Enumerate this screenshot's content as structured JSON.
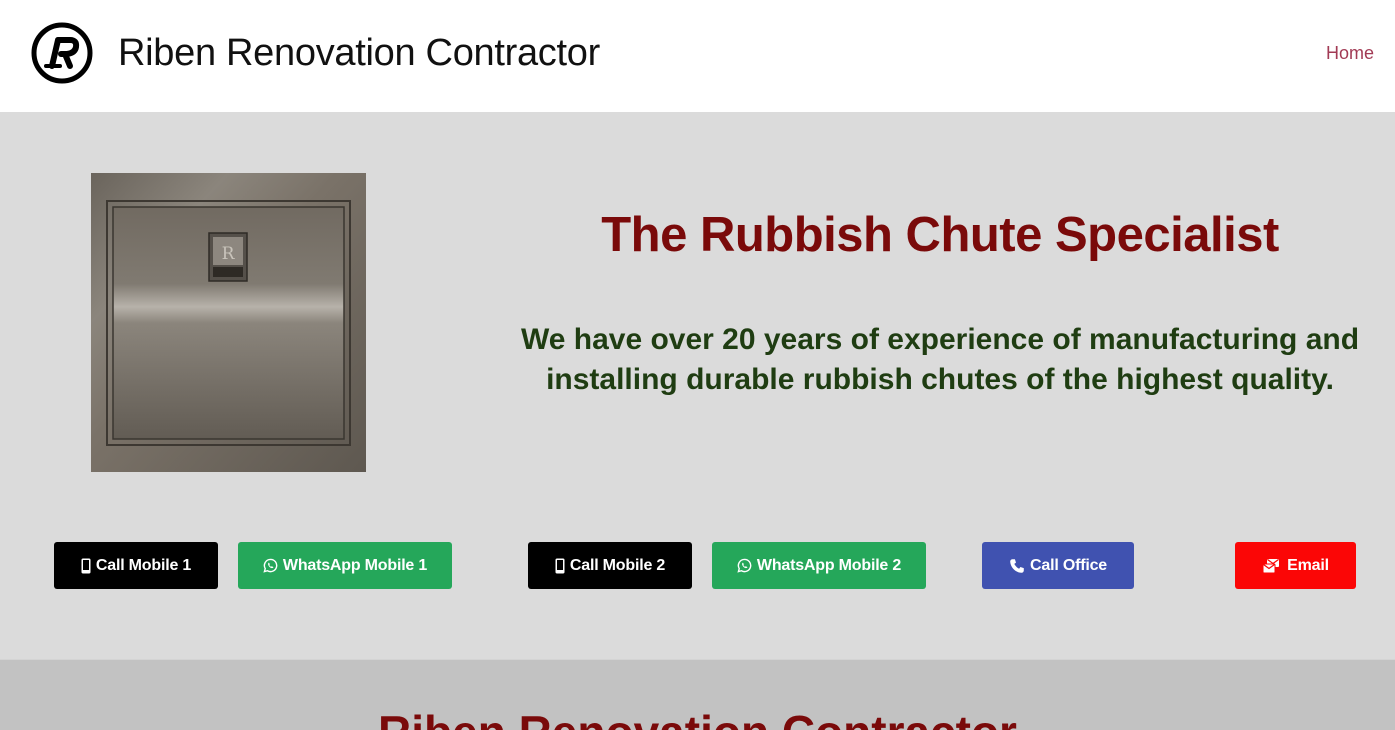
{
  "header": {
    "site_title": "Riben Renovation Contractor",
    "logo_icon": "riben-r-logo",
    "nav": [
      {
        "label": "Home"
      }
    ]
  },
  "hero": {
    "image": "stainless-steel-rubbish-chute-hopper-door",
    "image_monogram": "R",
    "headline": "The Rubbish Chute Specialist",
    "tagline": "We have over 20 years of experience of manufacturing and installing durable rubbish chutes of the highest quality.",
    "buttons": [
      {
        "label": "Call Mobile 1",
        "icon": "mobile-phone-icon",
        "color": "#000000"
      },
      {
        "label": "WhatsApp Mobile 1",
        "icon": "whatsapp-icon",
        "color": "#25a75a"
      },
      {
        "label": "Call Mobile 2",
        "icon": "mobile-phone-icon",
        "color": "#000000"
      },
      {
        "label": "WhatsApp Mobile 2",
        "icon": "whatsapp-icon",
        "color": "#25a75a"
      },
      {
        "label": "Call Office",
        "icon": "phone-icon",
        "color": "#4052b0"
      },
      {
        "label": "Email",
        "icon": "mail-icon",
        "color": "#fb0606"
      }
    ]
  },
  "section2": {
    "title": "Riben Renovation Contractor"
  },
  "colors": {
    "headline": "#7a0a0a",
    "tagline": "#1f3d12",
    "nav_link": "#a23b55",
    "hero_bg": "#dbdbdb",
    "section2_bg": "#c2c2c2"
  }
}
